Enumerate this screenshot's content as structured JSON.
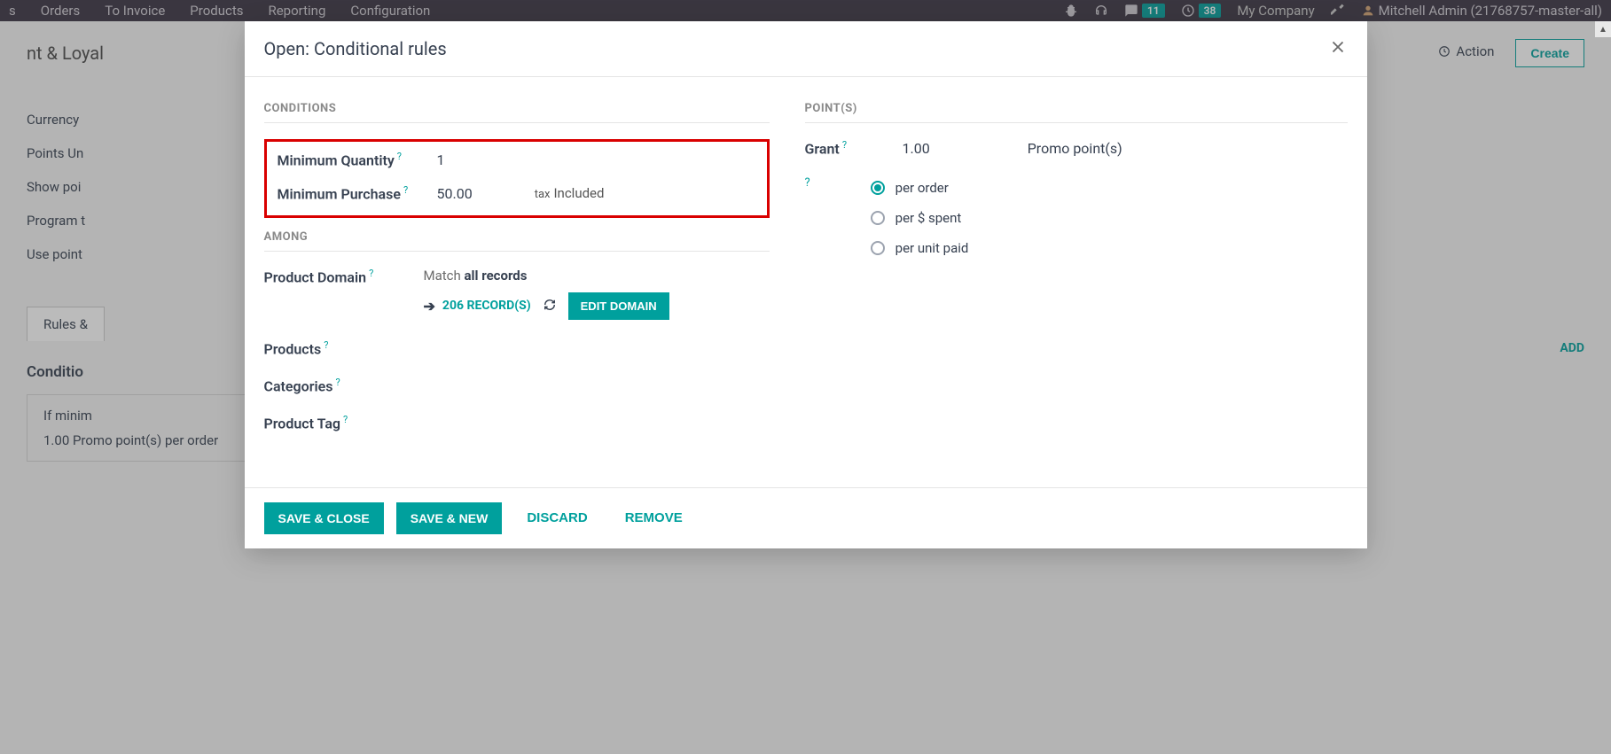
{
  "topbar": {
    "nav": [
      "s",
      "Orders",
      "To Invoice",
      "Products",
      "Reporting",
      "Configuration"
    ],
    "msg_badge": "11",
    "clock_badge": "38",
    "company": "My Company",
    "user": "Mitchell Admin (21768757-master-all)"
  },
  "page": {
    "title_fragment": "nt & Loyal",
    "action": "Action",
    "create": "Create",
    "bg_labels": [
      "Currency",
      "Points Un",
      "Show poi",
      "Program t",
      "Use point"
    ],
    "tab": "Rules &",
    "section": "Conditio",
    "add": "ADD",
    "rule_line1": "If minim",
    "rule_line2": "1.00 Promo point(s) per order"
  },
  "modal": {
    "title": "Open: Conditional rules",
    "sections": {
      "conditions": "CONDITIONS",
      "among": "AMONG",
      "points": "POINT(S)"
    },
    "fields": {
      "min_qty_label": "Minimum Quantity",
      "min_qty_value": "1",
      "min_purchase_label": "Minimum Purchase",
      "min_purchase_value": "50.00",
      "tax_small": "tax",
      "tax_included": "Included",
      "product_domain_label": "Product Domain",
      "match_prefix": "Match",
      "match_bold": "all records",
      "records_link": "206 RECORD(S)",
      "edit_domain": "EDIT DOMAIN",
      "products_label": "Products",
      "categories_label": "Categories",
      "product_tag_label": "Product Tag",
      "grant_label": "Grant",
      "grant_value": "1.00",
      "grant_unit": "Promo point(s)",
      "radio_per_order": "per order",
      "radio_per_spent": "per $ spent",
      "radio_per_unit": "per unit paid"
    },
    "footer": {
      "save_close": "SAVE & CLOSE",
      "save_new": "SAVE & NEW",
      "discard": "DISCARD",
      "remove": "REMOVE"
    }
  }
}
